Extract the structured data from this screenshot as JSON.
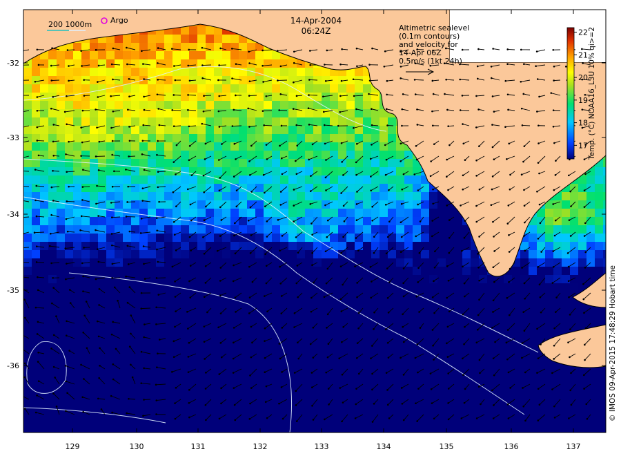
{
  "header": {
    "date": "14-Apr-2004",
    "time": "06:24Z"
  },
  "legend_top_left": {
    "scale_label": "200  1000m",
    "argo_label": "Argo",
    "argo_color": "#e000e0",
    "scale_line_color": "#20c0c0"
  },
  "annotation": {
    "lines": [
      "Altimetric sealevel",
      "(0.1m contours)",
      "and velocity for",
      "14-Apr 06Z",
      "0.5m/s (1kt 24h)"
    ]
  },
  "colorbar": {
    "ticks": [
      "17",
      "18",
      "19",
      "20",
      "21",
      "22"
    ],
    "min": 16.4,
    "max": 22.2,
    "label": "Temp. (°C) NOAA16_L3U 10% qi>=2"
  },
  "credit": "© IMOS 09-Apr-2015 17:48:29 Hobart time",
  "axes": {
    "x_ticks": [
      "129",
      "130",
      "131",
      "132",
      "133",
      "134",
      "135",
      "136",
      "137"
    ],
    "y_ticks": [
      "-32",
      "-33",
      "-34",
      "-35",
      "-36"
    ]
  },
  "colors": {
    "land": "#fbc89a",
    "warm": "#e07a1a",
    "cool": "#1a90e8"
  }
}
